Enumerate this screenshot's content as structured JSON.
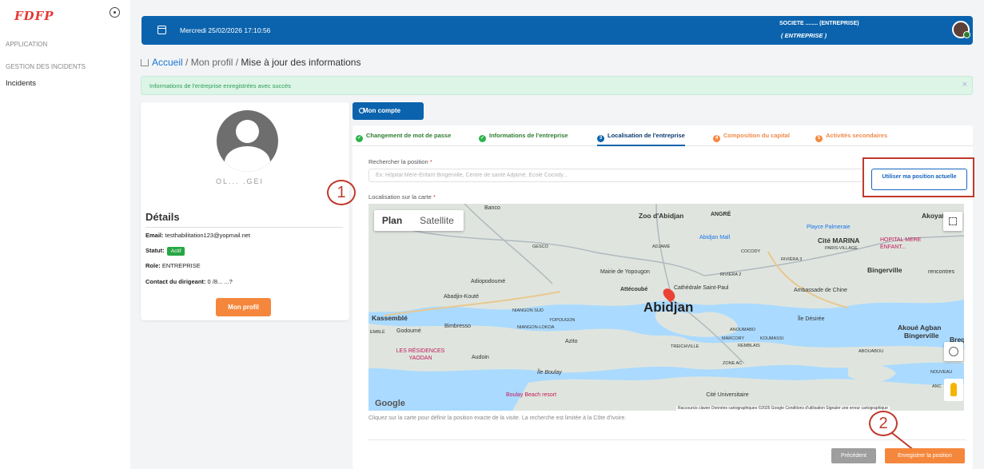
{
  "sidebar": {
    "logo": "FDFP",
    "sections": [
      "APPLICATION",
      "GESTION DES INCIDENTS"
    ],
    "items": [
      {
        "label": "Incidents"
      }
    ]
  },
  "topbar": {
    "datetime": "Mercredi 25/02/2026 17:10:56",
    "company": "SOCIETE ........ (ENTREPRISE)",
    "role": "( ENTREPRISE )"
  },
  "breadcrumb": {
    "home": "Accueil",
    "sep1": " / ",
    "profile": "Mon profil",
    "sep2": " / ",
    "current": "Mise à jour des informations"
  },
  "alert": {
    "message": "Informations de l'entreprise enregistrées avec succès",
    "close": "×"
  },
  "profile": {
    "name": "OL... .GEI",
    "details_title": "Détails",
    "email_label": "Email:",
    "email": "testhabilitation123@yopmail.net",
    "status_label": "Statut:",
    "status": "Actif",
    "role_label": "Role:",
    "role": "ENTREPRISE",
    "contact_label": "Contact du dirigeant:",
    "contact": "0 /8... ...?",
    "button": "Mon profil"
  },
  "account_button": "Mon compte",
  "tabs": [
    {
      "label": "Changement de mot de passe",
      "icon": "✓"
    },
    {
      "label": "Informations de l'entreprise",
      "icon": "✓"
    },
    {
      "label": "Localisation de l'entreprise",
      "icon": "3"
    },
    {
      "label": "Composition du capital",
      "icon": "4"
    },
    {
      "label": "Activités secondaires",
      "icon": "5"
    }
  ],
  "form": {
    "search_label": "Rechercher la position",
    "required": "*",
    "search_placeholder": "Ex: Hôpital Mère-Enfant Bingerville, Centre de santé Adjamé, École Cocody...",
    "use_position": "Utiliser ma position actuelle",
    "map_label": "Localisation sur la carte",
    "hint": "Cliquez sur la carte pour définir la position exacte de la visite. La recherche est limitée à la Côte d'Ivoire."
  },
  "map": {
    "types": [
      "Plan",
      "Satellite"
    ],
    "google": "Google",
    "attribution": "Raccourcis clavier   Données cartographiques ©2026 Google   Conditions d'utilisation   Signaler une erreur cartographique",
    "labels": {
      "banco": "Banco",
      "zoo": "Zoo d'Abidjan",
      "angre": "ANGRÉ",
      "akoyate": "Akoyate",
      "playce": "Playce Palmeraie",
      "abidjanmall": "Abidjan Mall",
      "citemarina": "Cité MARINA",
      "parisvillage": "PARIS-VILLAGE",
      "hopital": "HOPITAL MERE ENFANT...",
      "cocody": "COCODY",
      "riviera3": "RIVIÈRA 3",
      "riviera2": "RIVIÈRA 2",
      "bingerville": "Bingerville",
      "rencontres": "rencontres",
      "gesco": "GESCO",
      "adjame": "ADJAMÉ",
      "mairie": "Mairie de Yopougon",
      "adiopo": "Adiopodoumé",
      "attecoube": "Attécoubé",
      "cathedrale": "Cathédrale Saint-Paul",
      "ambassade": "Ambassade de Chine",
      "abadjin": "Abadjin-Kouté",
      "niangonsud": "NIANGON SUD",
      "abidjan": "Abidjan",
      "yopougon": "YOPOUGON",
      "kassemble": "Kassemblé",
      "bimbresso": "Bimbresso",
      "niangonlokoa": "NIANGON-LOKOA",
      "iledesiree": "Île Désirée",
      "akoue": "Akoué Agban",
      "bingerville2": "Bingerville",
      "bregb": "Bregb",
      "godoume": "Godoumé",
      "emble": "EMBLÉ",
      "anoumabo": "ANOUMABO",
      "marcory": "MARCORY",
      "koumassi": "KOUMASSI",
      "azito": "Azito",
      "treichville": "TREICHVILLE",
      "remblais": "REMBLAIS",
      "residences": "LES RÉSIDENCES YAODAN",
      "audoin": "Audoin",
      "zoneac": "ZONE AC",
      "abouabou": "ABOUABOU",
      "nouveau": "NOUVEAU",
      "ileboulay": "Île Boulay",
      "boulay": "Boulay Beach resort",
      "anc": "ANC",
      "cite": "Cité Universitaire"
    }
  },
  "buttons": {
    "prev": "Précédent",
    "save": "Enregistrer la position"
  },
  "annotations": [
    "1",
    "2"
  ],
  "colors": {
    "primary": "#0b63ad",
    "accent": "#f5873d",
    "success": "#2db34a",
    "annotation": "#c0392b"
  }
}
